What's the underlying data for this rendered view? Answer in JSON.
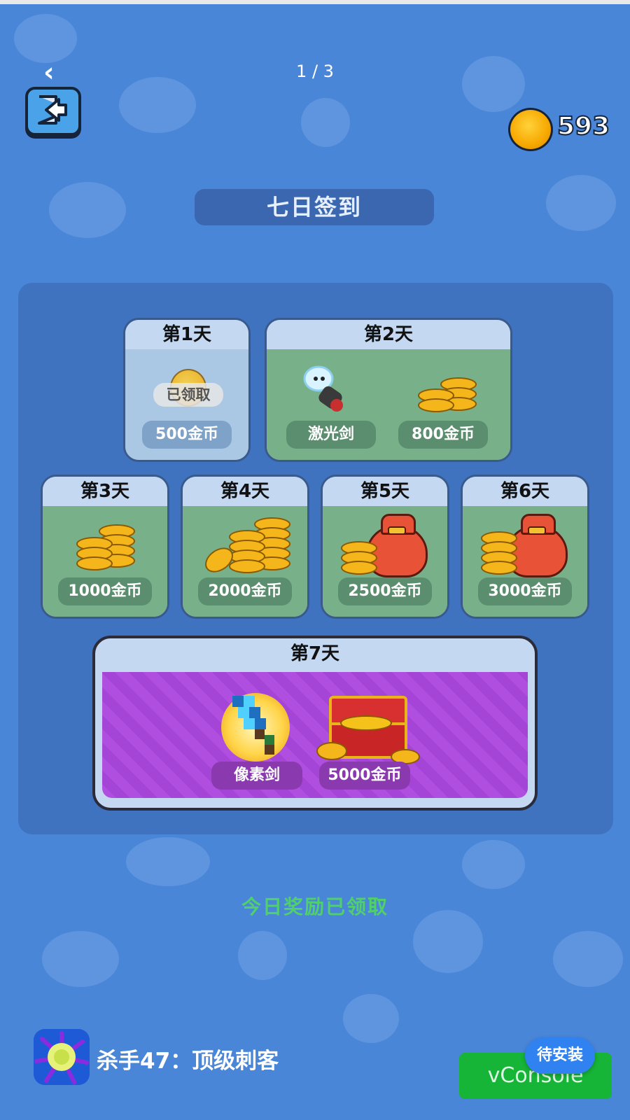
{
  "header": {
    "page_indicator": "1 / 3",
    "coin_balance": "593"
  },
  "title": "七日签到",
  "days": [
    {
      "label": "第1天",
      "rewards": [
        "500金币"
      ],
      "claimed_badge": "已领取",
      "claimed": true
    },
    {
      "label": "第2天",
      "rewards": [
        "激光剑",
        "800金币"
      ],
      "claimed": false
    },
    {
      "label": "第3天",
      "rewards": [
        "1000金币"
      ],
      "claimed": false
    },
    {
      "label": "第4天",
      "rewards": [
        "2000金币"
      ],
      "claimed": false
    },
    {
      "label": "第5天",
      "rewards": [
        "2500金币"
      ],
      "claimed": false
    },
    {
      "label": "第6天",
      "rewards": [
        "3000金币"
      ],
      "claimed": false
    },
    {
      "label": "第7天",
      "rewards": [
        "像素剑",
        "5000金币"
      ],
      "claimed": false
    }
  ],
  "status_message": "今日奖励已领取",
  "footer": {
    "app_name": "杀手47：顶级刺客",
    "vconsole_label": "vConsole",
    "install_badge": "待安装"
  },
  "colors": {
    "background": "#4a86d8",
    "panel": "#3f73c0",
    "status_green": "#4fd06a",
    "day7_purple": "#b04ee0",
    "vconsole_green": "#16b437",
    "install_blue": "#2f82f0"
  },
  "icons": [
    "back-chevron-icon",
    "exit-door-icon",
    "gold-coin-icon",
    "laser-sword-icon",
    "coin-stack-icon",
    "money-bag-icon",
    "pixel-sword-icon",
    "treasure-chest-icon",
    "app-icon"
  ]
}
